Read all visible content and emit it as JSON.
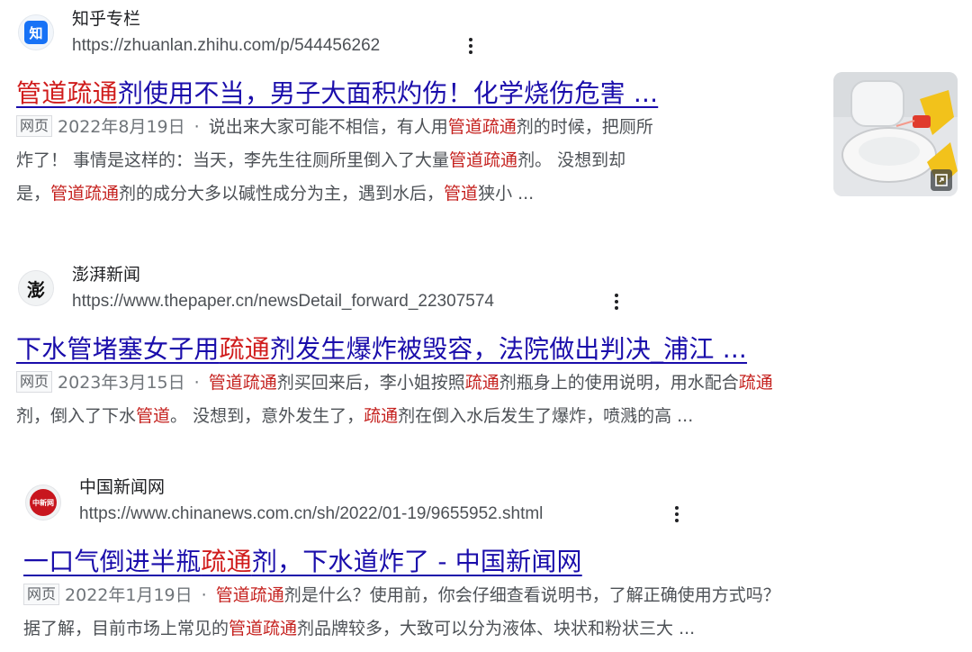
{
  "results": [
    {
      "site_name": "知乎专栏",
      "favicon_text": "知",
      "url": "https://zhuanlan.zhihu.com/p/544456262",
      "title_parts": [
        "管道疏通",
        "剂使用不当，男子大面积灼伤！化学烧伤危害 ..."
      ],
      "tag": "网页",
      "date": "2022年8月19日",
      "snippet_lines": [
        [
          "说出来大家可能不相信，有人用",
          "管道疏通",
          "剂的时候，把厕所"
        ],
        [
          "炸了！ 事情是这样的：当天，李先生往厕所里倒入了大量",
          "管道疏通",
          "剂。 没想到却"
        ],
        [
          "是，",
          "管道疏通",
          "剂的成分大多以碱性成分为主，遇到水后，",
          "管道",
          "狭小 ..."
        ]
      ],
      "thumbnail_icon": "image-thumbnail-icon"
    },
    {
      "site_name": "澎湃新闻",
      "favicon_text": "澎",
      "url": "https://www.thepaper.cn/newsDetail_forward_22307574",
      "title_parts": [
        "下水管堵塞女子用",
        "疏通",
        "剂发生爆炸被毁容，法院做出判决_浦江 ..."
      ],
      "tag": "网页",
      "date": "2023年3月15日",
      "snippet_lines": [
        [
          "管道疏通",
          "剂买回来后，李小姐按照",
          "疏通",
          "剂瓶身上的使用说明，用水配合",
          "疏通"
        ],
        [
          "剂，倒入了下水",
          "管道",
          "。 没想到，意外发生了，",
          "疏通",
          "剂在倒入水后发生了爆炸，喷溅的高 ..."
        ]
      ]
    },
    {
      "site_name": "中国新闻网",
      "favicon_text": "中新网",
      "url": "https://www.chinanews.com.cn/sh/2022/01-19/9655952.shtml",
      "title_parts": [
        "一口气倒进半瓶",
        "疏通",
        "剂，下水道炸了 - 中国新闻网"
      ],
      "tag": "网页",
      "date": "2022年1月19日",
      "snippet_lines": [
        [
          "管道疏通",
          "剂是什么？使用前，你会仔细查看说明书，了解正确使用方式吗？"
        ],
        [
          "据了解，目前市场上常见的",
          "管道疏通",
          "剂品牌较多，大致可以分为液体、块状和粉状三大 ..."
        ]
      ]
    }
  ]
}
